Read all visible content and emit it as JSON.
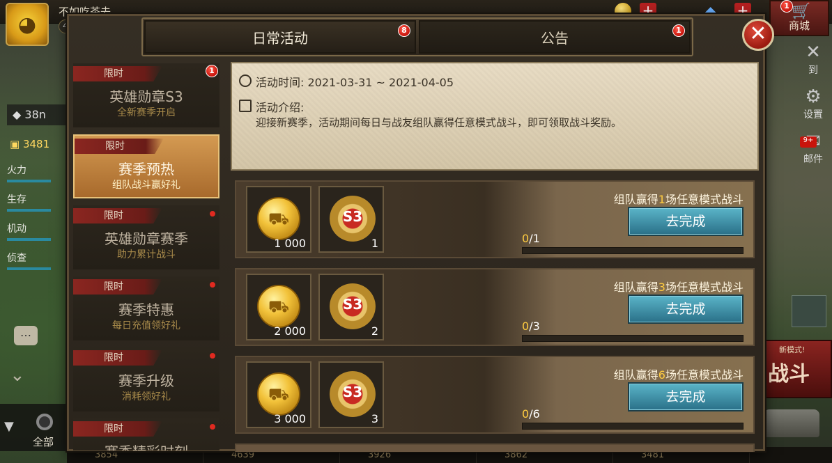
{
  "player": {
    "name": "不如吃茶去",
    "level": "40"
  },
  "top_bar": {
    "shop_label": "商城",
    "shop_badge": "1"
  },
  "bg_left": {
    "rank": "38n",
    "gold": "3481",
    "stats": [
      "火力",
      "生存",
      "机动",
      "侦查"
    ],
    "filter_label": "全部"
  },
  "bg_right": {
    "sign_label": "到",
    "settings_label": "设置",
    "mail_label": "邮件",
    "mail_badge": "9+",
    "new_mode": "新模式!",
    "battle_label": "战斗"
  },
  "bottom_strip": [
    "3854",
    "4639",
    "3926",
    "3862",
    "3481"
  ],
  "tabs": [
    {
      "label": "日常活动",
      "badge": "8",
      "active": true
    },
    {
      "label": "公告",
      "badge": "1",
      "active": false
    }
  ],
  "sidebar": [
    {
      "tag": "限时",
      "title": "英雄勋章S3",
      "subtitle": "全新赛季开启",
      "badge": "1",
      "selected": false
    },
    {
      "tag": "限时",
      "title": "赛季预热",
      "subtitle": "组队战斗赢好礼",
      "badge": "",
      "selected": true
    },
    {
      "tag": "限时",
      "title": "英雄勋章赛季",
      "subtitle": "助力累计战斗",
      "badge": "dot",
      "selected": false
    },
    {
      "tag": "限时",
      "title": "赛季特惠",
      "subtitle": "每日充值领好礼",
      "badge": "dot",
      "selected": false
    },
    {
      "tag": "限时",
      "title": "赛季升级",
      "subtitle": "消耗领好礼",
      "badge": "dot",
      "selected": false
    },
    {
      "tag": "限时",
      "title": "赛季精彩时刻",
      "subtitle": "",
      "badge": "dot",
      "selected": false
    }
  ],
  "info": {
    "time_label": "活动时间: 2021-03-31 ~ 2021-04-05",
    "desc_label": "活动介绍:",
    "desc_text": "迎接新赛季，活动期间每日与战友组队赢得任意模式战斗，即可领取战斗奖励。"
  },
  "tasks": [
    {
      "title_prefix": "组队赢得",
      "title_num": "1",
      "title_suffix": "场任意模式战斗",
      "coin_amount": "1 000",
      "medal_count": "1",
      "medal_text": "S3",
      "progress_cur": "0",
      "progress_total": "/1",
      "progress_fraction": 0,
      "button": "去完成"
    },
    {
      "title_prefix": "组队赢得",
      "title_num": "3",
      "title_suffix": "场任意模式战斗",
      "coin_amount": "2 000",
      "medal_count": "2",
      "medal_text": "S3",
      "progress_cur": "0",
      "progress_total": "/3",
      "progress_fraction": 0,
      "button": "去完成"
    },
    {
      "title_prefix": "组队赢得",
      "title_num": "6",
      "title_suffix": "场任意模式战斗",
      "coin_amount": "3 000",
      "medal_count": "3",
      "medal_text": "S3",
      "progress_cur": "0",
      "progress_total": "/6",
      "progress_fraction": 0,
      "button": "去完成"
    }
  ],
  "colors": {
    "accent_gold": "#ffcc40",
    "button_teal": "#3a8aa2",
    "badge_red": "#c8140c",
    "selected_item": "#c08040"
  }
}
